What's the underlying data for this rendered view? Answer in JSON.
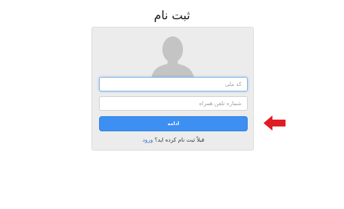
{
  "page": {
    "title": "ثبت نام"
  },
  "form": {
    "national_id_placeholder": "کد ملی",
    "phone_placeholder": "شماره تلفن همراه",
    "continue_label": "ادامه",
    "login_prompt": "قبلاً ثبت نام کرده اید؟",
    "login_link": "ورود"
  },
  "colors": {
    "primary_button": "#3d8ff2",
    "link": "#2f6fbf",
    "card_background": "#ececec",
    "arrow": "#e01b24"
  },
  "icons": {
    "avatar": "user-silhouette-icon",
    "pointer": "arrow-left-icon"
  }
}
